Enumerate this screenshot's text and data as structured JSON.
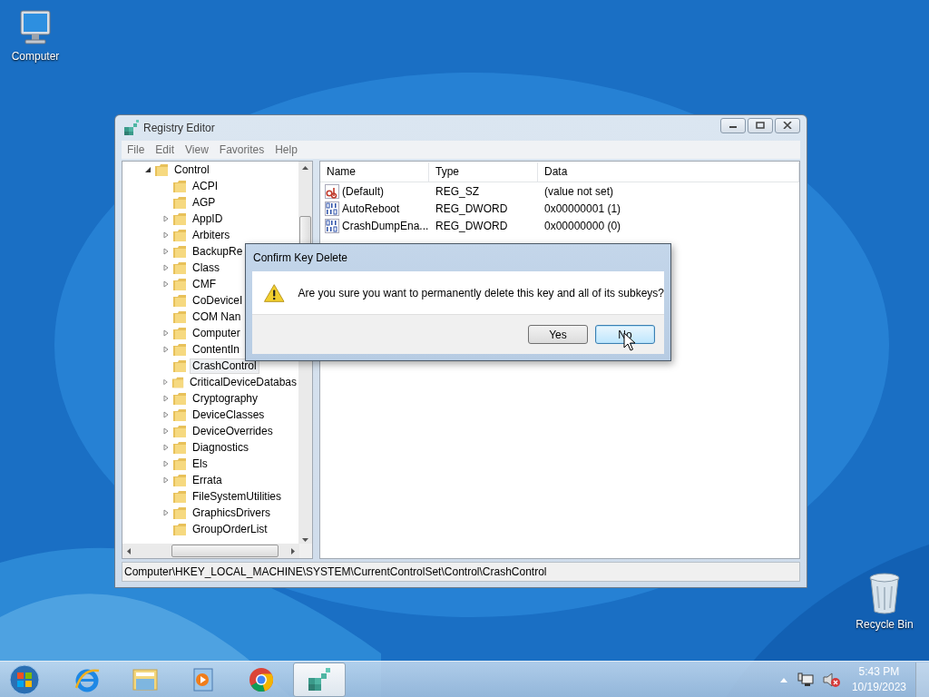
{
  "desktop_icons": [
    {
      "kind": "computer",
      "label": "Computer"
    },
    {
      "kind": "recycle",
      "label": "Recycle Bin"
    }
  ],
  "window": {
    "title": "Registry Editor",
    "menu": [
      "File",
      "Edit",
      "View",
      "Favorites",
      "Help"
    ],
    "tree": {
      "label": "Control",
      "expanded": true,
      "children": [
        {
          "label": "ACPI",
          "expandable": false,
          "selected": false
        },
        {
          "label": "AGP",
          "expandable": false,
          "selected": false
        },
        {
          "label": "AppID",
          "expandable": true,
          "selected": false
        },
        {
          "label": "Arbiters",
          "expandable": true,
          "selected": false
        },
        {
          "label": "BackupRe",
          "expandable": true,
          "selected": false
        },
        {
          "label": "Class",
          "expandable": true,
          "selected": false
        },
        {
          "label": "CMF",
          "expandable": true,
          "selected": false
        },
        {
          "label": "CoDeviceI",
          "expandable": false,
          "selected": false
        },
        {
          "label": "COM Nan",
          "expandable": false,
          "selected": false
        },
        {
          "label": "Computer",
          "expandable": true,
          "selected": false
        },
        {
          "label": "ContentIn",
          "expandable": true,
          "selected": false
        },
        {
          "label": "CrashControl",
          "expandable": false,
          "selected": true
        },
        {
          "label": "CriticalDeviceDatabas",
          "expandable": true,
          "selected": false
        },
        {
          "label": "Cryptography",
          "expandable": true,
          "selected": false
        },
        {
          "label": "DeviceClasses",
          "expandable": true,
          "selected": false
        },
        {
          "label": "DeviceOverrides",
          "expandable": true,
          "selected": false
        },
        {
          "label": "Diagnostics",
          "expandable": true,
          "selected": false
        },
        {
          "label": "Els",
          "expandable": true,
          "selected": false
        },
        {
          "label": "Errata",
          "expandable": true,
          "selected": false
        },
        {
          "label": "FileSystemUtilities",
          "expandable": false,
          "selected": false
        },
        {
          "label": "GraphicsDrivers",
          "expandable": true,
          "selected": false
        },
        {
          "label": "GroupOrderList",
          "expandable": false,
          "selected": false
        }
      ]
    },
    "columns": [
      "Name",
      "Type",
      "Data"
    ],
    "values": [
      {
        "kind": "string",
        "name": "(Default)",
        "type": "REG_SZ",
        "data": "(value not set)"
      },
      {
        "kind": "binary",
        "name": "AutoReboot",
        "type": "REG_DWORD",
        "data": "0x00000001 (1)"
      },
      {
        "kind": "binary",
        "name": "CrashDumpEna...",
        "type": "REG_DWORD",
        "data": "0x00000000 (0)"
      }
    ],
    "status_bar": "Computer\\HKEY_LOCAL_MACHINE\\SYSTEM\\CurrentControlSet\\Control\\CrashControl"
  },
  "dialog": {
    "title": "Confirm Key Delete",
    "message": "Are you sure you want to permanently delete this key and all of its subkeys?",
    "buttons": [
      {
        "label": "Yes",
        "default": false
      },
      {
        "label": "No",
        "default": true
      }
    ]
  },
  "taskbar": {
    "apps": [
      {
        "kind": "browser-e",
        "active": false
      },
      {
        "kind": "folder",
        "active": false
      },
      {
        "kind": "media",
        "active": false
      },
      {
        "kind": "chrome",
        "active": false
      },
      {
        "kind": "cubes",
        "active": true
      }
    ],
    "time": "5:43 PM",
    "date": "10/19/2023"
  }
}
